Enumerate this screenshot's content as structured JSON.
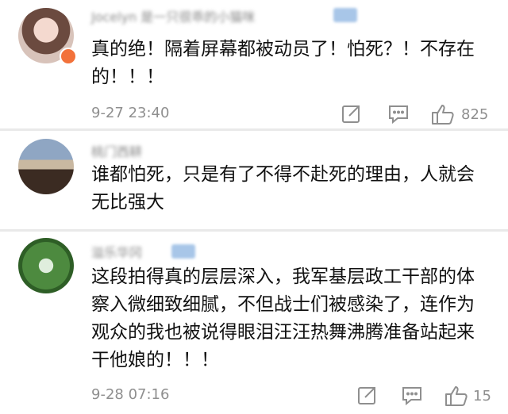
{
  "comments": [
    {
      "username": "Jocelyn 是一只很乖的小猫咪",
      "text": "真的绝！隔着屏幕都被动员了！怕死？！不存在的！！！",
      "time": "9-27 23:40",
      "like_count": "825",
      "has_badge": true
    },
    {
      "username": "桃门西耕",
      "text": "谁都怕死，只是有了不得不赴死的理由，人就会无比强大"
    },
    {
      "username": "溢乐华冈",
      "text": "这段拍得真的层层深入，我军基层政工干部的体察入微细致细腻，不但战士们被感染了，连作为观众的我也被说得眼泪汪汪热舞沸腾准备站起来干他娘的！！！",
      "time": "9-28 07:16",
      "like_count": "15"
    }
  ],
  "icons": {
    "share": "share-icon",
    "reply": "comment-icon",
    "like": "thumbs-up-icon"
  },
  "colors": {
    "meta_gray": "#8f8f8f",
    "divider": "#e9e9e9",
    "badge_orange": "#f2713a"
  }
}
